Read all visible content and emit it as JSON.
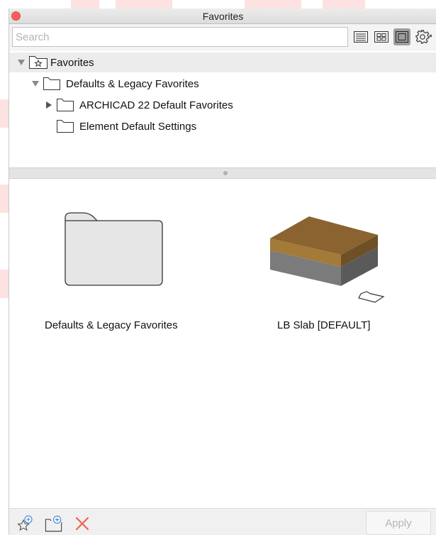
{
  "window": {
    "title": "Favorites"
  },
  "search": {
    "placeholder": "Search",
    "value": ""
  },
  "view_modes": [
    {
      "icon": "list-view-icon",
      "active": false
    },
    {
      "icon": "grid-view-icon",
      "active": false
    },
    {
      "icon": "preview-view-icon",
      "active": true
    }
  ],
  "settings_icon": "gear-icon",
  "tree": {
    "root": {
      "label": "Favorites",
      "expanded": true,
      "icon": "star-folder-icon"
    },
    "items": [
      {
        "label": "Defaults & Legacy Favorites",
        "expanded": true,
        "icon": "folder-icon"
      },
      {
        "label": "ARCHICAD 22 Default Favorites",
        "expanded": false,
        "icon": "folder-icon"
      },
      {
        "label": "Element Default Settings",
        "icon": "folder-icon"
      }
    ]
  },
  "content": {
    "items": [
      {
        "label": "Defaults & Legacy Favorites",
        "type": "folder",
        "icon": "folder-large-icon"
      },
      {
        "label": "LB Slab [DEFAULT]",
        "type": "slab",
        "icon": "slab-preview-icon"
      }
    ]
  },
  "bottom_bar": {
    "icons": [
      "new-favorite-icon",
      "new-folder-icon",
      "delete-icon"
    ],
    "apply_label": "Apply"
  },
  "colors": {
    "close_button": "#fc605c",
    "slab_top": "#8a6331",
    "slab_side_brown": "#a47a38",
    "slab_side_gray": "#7b7b7b",
    "delete_icon": "#f0644c",
    "accent_blue": "#3a7bd5"
  }
}
